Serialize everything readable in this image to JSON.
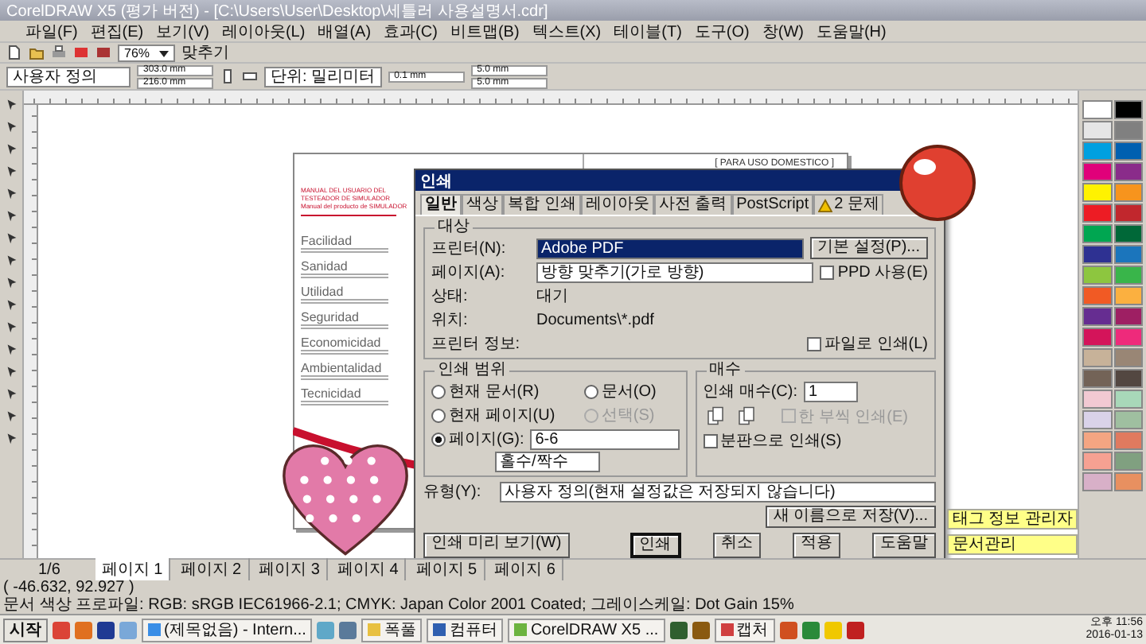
{
  "window": {
    "title": "CorelDRAW X5 (평가 버전) - [C:\\Users\\User\\Desktop\\세틀러 사용설명서.cdr]"
  },
  "menu": [
    "파일(F)",
    "편집(E)",
    "보기(V)",
    "레이아웃(L)",
    "배열(A)",
    "효과(C)",
    "비트맵(B)",
    "텍스트(X)",
    "테이블(T)",
    "도구(O)",
    "창(W)",
    "도움말(H)"
  ],
  "toolbar": {
    "zoom": "76%",
    "snap": "맞추기"
  },
  "property_bar": {
    "page_size": "사용자 정의",
    "width": "303.0 mm",
    "height": "216.0 mm",
    "units": "단위: 밀리미터",
    "nudge": "0.1 mm",
    "dup_x": "5.0 mm",
    "dup_y": "5.0 mm"
  },
  "document": {
    "left_page": {
      "header": [
        "MANUAL DEL USUARIO DEL TESTEADOR DE SIMULADOR",
        "Manual del producto de SIMULADOR"
      ],
      "sections": [
        "Facilidad",
        "Sanidad",
        "Utilidad",
        "Seguridad",
        "Economicidad",
        "Ambientalidad",
        "Tecnicidad"
      ]
    },
    "right_page": {
      "heading": "[ PARA USO DOMESTICO ]"
    }
  },
  "print_dialog": {
    "title": "인쇄",
    "tabs": [
      {
        "label": "일반",
        "selected": true,
        "kind": "text"
      },
      {
        "label": "색상",
        "selected": false,
        "kind": "text"
      },
      {
        "label": "복합 인쇄",
        "selected": false,
        "kind": "text"
      },
      {
        "label": "레이아웃",
        "selected": false,
        "kind": "text"
      },
      {
        "label": "사전 출력",
        "selected": false,
        "kind": "text"
      },
      {
        "label": "PostScript",
        "selected": false,
        "kind": "text"
      },
      {
        "label": "2 문제",
        "selected": false,
        "kind": "warning"
      }
    ],
    "target": {
      "heading": "대상",
      "printer_label": "프린터(N):",
      "printer": "Adobe PDF",
      "preferences": "기본 설정(P)...",
      "page_label": "페이지(A):",
      "page": "방향 맞추기(가로 방향)",
      "ppd": {
        "label": "PPD 사용(E)",
        "checked": false
      },
      "status_label": "상태:",
      "status": "대기",
      "where_label": "위치:",
      "where": "Documents\\*.pdf",
      "info_label": "프린터 정보:",
      "print_to_file": {
        "label": "파일로 인쇄(L)",
        "checked": false
      }
    },
    "range": {
      "heading": "인쇄 범위",
      "options": [
        {
          "label": "현재 문서(R)",
          "selected": false,
          "disabled": false
        },
        {
          "label": "문서(O)",
          "selected": false,
          "disabled": false
        },
        {
          "label": "현재 페이지(U)",
          "selected": false,
          "disabled": false
        },
        {
          "label": "선택(S)",
          "selected": false,
          "disabled": true
        },
        {
          "label": "페이지(G):",
          "selected": true,
          "disabled": false
        }
      ],
      "pages": "6-6",
      "parity": "홀수/짝수"
    },
    "copies": {
      "heading": "매수",
      "label": "인쇄 매수(C):",
      "value": "1",
      "collate": {
        "label": "한 부씩 인쇄(E)",
        "checked": false,
        "disabled": true
      }
    },
    "separations": {
      "label": "분판으로 인쇄(S)",
      "checked": false
    },
    "style_label": "유형(Y):",
    "style": "사용자 정의(현재 설정값은 저장되지 않습니다)",
    "save_as": "새 이름으로 저장(V)...",
    "buttons": [
      {
        "label": "인쇄 미리 보기(W)",
        "kind": "preview"
      },
      {
        "label": "인쇄",
        "kind": "default"
      },
      {
        "label": "취소",
        "kind": "normal"
      },
      {
        "label": "적용",
        "kind": "normal"
      },
      {
        "label": "도움말",
        "kind": "normal"
      }
    ]
  },
  "page_tabs": {
    "counter": "1/6",
    "tabs": [
      {
        "label": "페이지 1",
        "selected": true
      },
      {
        "label": "페이지 2",
        "selected": false
      },
      {
        "label": "페이지 3",
        "selected": false
      },
      {
        "label": "페이지 4",
        "selected": false
      },
      {
        "label": "페이지 5",
        "selected": false
      },
      {
        "label": "페이지 6",
        "selected": false
      }
    ]
  },
  "status_bar": {
    "coords": "( -46.632, 92.927 )",
    "profile": "문서 색상 프로파일: RGB: sRGB IEC61966-2.1; CMYK: Japan Color 2001 Coated; 그레이스케일: Dot Gain 15%"
  },
  "tray_popups": [
    "태그 정보 관리자",
    "문서관리"
  ],
  "palette": [
    {
      "color": "#ffffff"
    },
    {
      "color": "#000000"
    },
    {
      "color": "#e6e6e6"
    },
    {
      "color": "#808080"
    },
    {
      "color": "#00a0e0"
    },
    {
      "color": "#0060b0"
    },
    {
      "color": "#e0007a"
    },
    {
      "color": "#8a2c8a"
    },
    {
      "color": "#fff200"
    },
    {
      "color": "#f7941d"
    },
    {
      "color": "#ed1c24"
    },
    {
      "color": "#c1272d"
    },
    {
      "color": "#00a651"
    },
    {
      "color": "#006838"
    },
    {
      "color": "#2e3192"
    },
    {
      "color": "#1b75bc"
    },
    {
      "color": "#8dc63f"
    },
    {
      "color": "#39b54a"
    },
    {
      "color": "#f15a24"
    },
    {
      "color": "#fbb040"
    },
    {
      "color": "#662d91"
    },
    {
      "color": "#9e1f63"
    },
    {
      "color": "#d4145a"
    },
    {
      "color": "#ee2a7b"
    },
    {
      "color": "#c7b299"
    },
    {
      "color": "#998675"
    },
    {
      "color": "#736357"
    },
    {
      "color": "#534741"
    },
    {
      "color": "#f2c9d2"
    },
    {
      "color": "#a8d8b9"
    },
    {
      "color": "#d9d2e9"
    },
    {
      "color": "#9fbfa0"
    },
    {
      "color": "#f4a582"
    },
    {
      "color": "#e07a5f"
    },
    {
      "color": "#f6a192"
    },
    {
      "color": "#80a080"
    },
    {
      "color": "#d8b0c8"
    },
    {
      "color": "#e89060"
    }
  ],
  "taskbar": {
    "start": "시작",
    "items": [
      {
        "kind": "icon",
        "color": "#db4437"
      },
      {
        "kind": "icon",
        "color": "#e07020"
      },
      {
        "kind": "icon",
        "color": "#1f3a93"
      },
      {
        "kind": "icon",
        "color": "#7aa8d8"
      },
      {
        "kind": "button",
        "label": "(제목없음) - Intern...",
        "color": "#3a8ee6"
      },
      {
        "kind": "icon",
        "color": "#5fa8c8"
      },
      {
        "kind": "icon",
        "color": "#5a7a9a"
      },
      {
        "kind": "button",
        "label": "폭풀",
        "color": "#e8c040"
      },
      {
        "kind": "button",
        "label": "컴퓨터",
        "color": "#3060b0"
      },
      {
        "kind": "button",
        "label": "CorelDRAW X5 ...",
        "color": "#6cb33f"
      },
      {
        "kind": "icon",
        "color": "#2f5f2f"
      },
      {
        "kind": "icon",
        "color": "#8a5a10"
      },
      {
        "kind": "button",
        "label": "캡처",
        "color": "#d04040"
      },
      {
        "kind": "icon",
        "color": "#d05020"
      },
      {
        "kind": "icon",
        "color": "#2a8a3a"
      },
      {
        "kind": "icon",
        "color": "#f0c800"
      },
      {
        "kind": "icon",
        "color": "#c02020"
      }
    ],
    "clock": {
      "time": "오후 11:56",
      "date": "2016-01-13"
    }
  }
}
